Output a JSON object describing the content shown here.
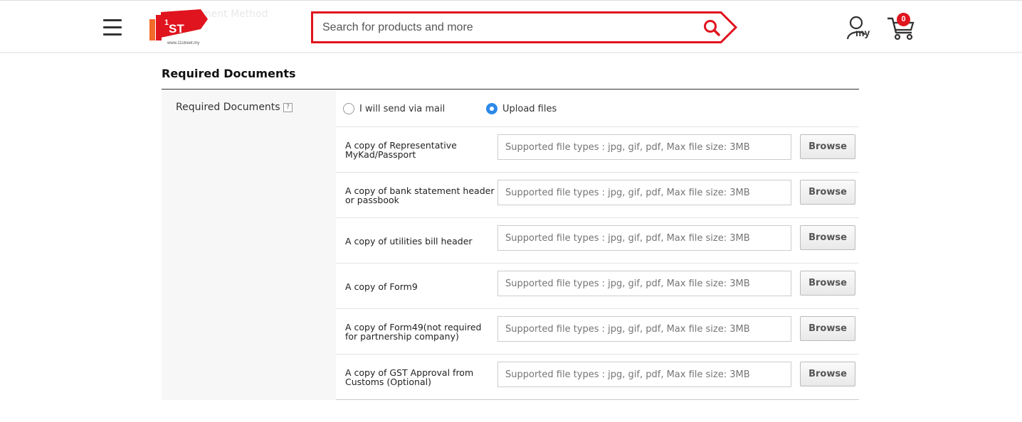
{
  "header": {
    "ghost_text": "ment Method",
    "search": {
      "placeholder": "Search for products and more"
    },
    "account_label": "my",
    "cart_count": "0",
    "logo": {
      "main": "ST",
      "sup": "1",
      "url": "www.11street.my"
    }
  },
  "section": {
    "title": "Required Documents",
    "label": "Required Documents",
    "help": "?"
  },
  "delivery_options": [
    {
      "label": "I will send via mail",
      "selected": false
    },
    {
      "label": "Upload files",
      "selected": true
    }
  ],
  "documents": [
    {
      "name": "A copy of Representative MyKad/Passport",
      "placeholder": "Supported file types : jpg, gif, pdf, Max file size: 3MB",
      "button": "Browse"
    },
    {
      "name": "A copy of bank statement header or passbook",
      "placeholder": "Supported file types : jpg, gif, pdf, Max file size: 3MB",
      "button": "Browse"
    },
    {
      "name": "A copy of utilities bill header",
      "placeholder": "Supported file types : jpg, gif, pdf, Max file size: 3MB",
      "button": "Browse"
    },
    {
      "name": "A copy of Form9",
      "placeholder": "Supported file types : jpg, gif, pdf, Max file size: 3MB",
      "button": "Browse"
    },
    {
      "name": "A copy of Form49(not required for partnership company)",
      "placeholder": "Supported file types : jpg, gif, pdf, Max file size: 3MB",
      "button": "Browse"
    },
    {
      "name": "A copy of GST Approval from Customs (Optional)",
      "placeholder": "Supported file types : jpg, gif, pdf, Max file size: 3MB",
      "button": "Browse"
    }
  ],
  "colors": {
    "brand_red": "#e0141f",
    "radio_blue": "#2d8ae8"
  },
  "icons": [
    "menu-icon",
    "search-icon",
    "account-icon",
    "cart-icon",
    "help-icon"
  ]
}
